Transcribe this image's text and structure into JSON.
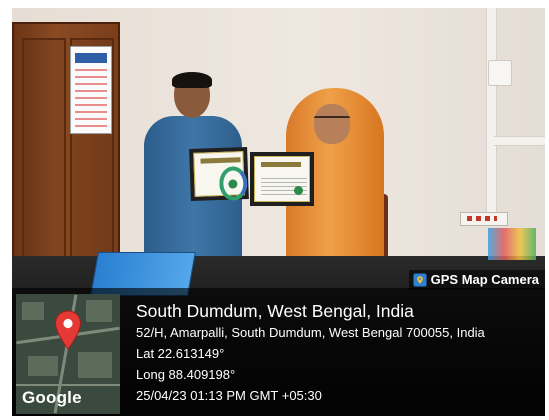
{
  "gps_camera_label": "GPS Map Camera",
  "location": {
    "title": "South Dumdum, West Bengal, India",
    "address": "52/H, Amarpalli, South Dumdum, West Bengal 700055, India",
    "latitude": "Lat 22.613149°",
    "longitude": "Long 88.409198°",
    "timestamp": "25/04/23 01:13 PM GMT +05:30"
  },
  "map_watermark": "Google",
  "icons": {
    "map_pin": "map-pin-icon",
    "camera": "gps-map-camera-icon"
  },
  "colors": {
    "overlay": "#000000",
    "pin": "#e53935",
    "scarf": "#f0a048",
    "shirt": "#3e76a8"
  }
}
